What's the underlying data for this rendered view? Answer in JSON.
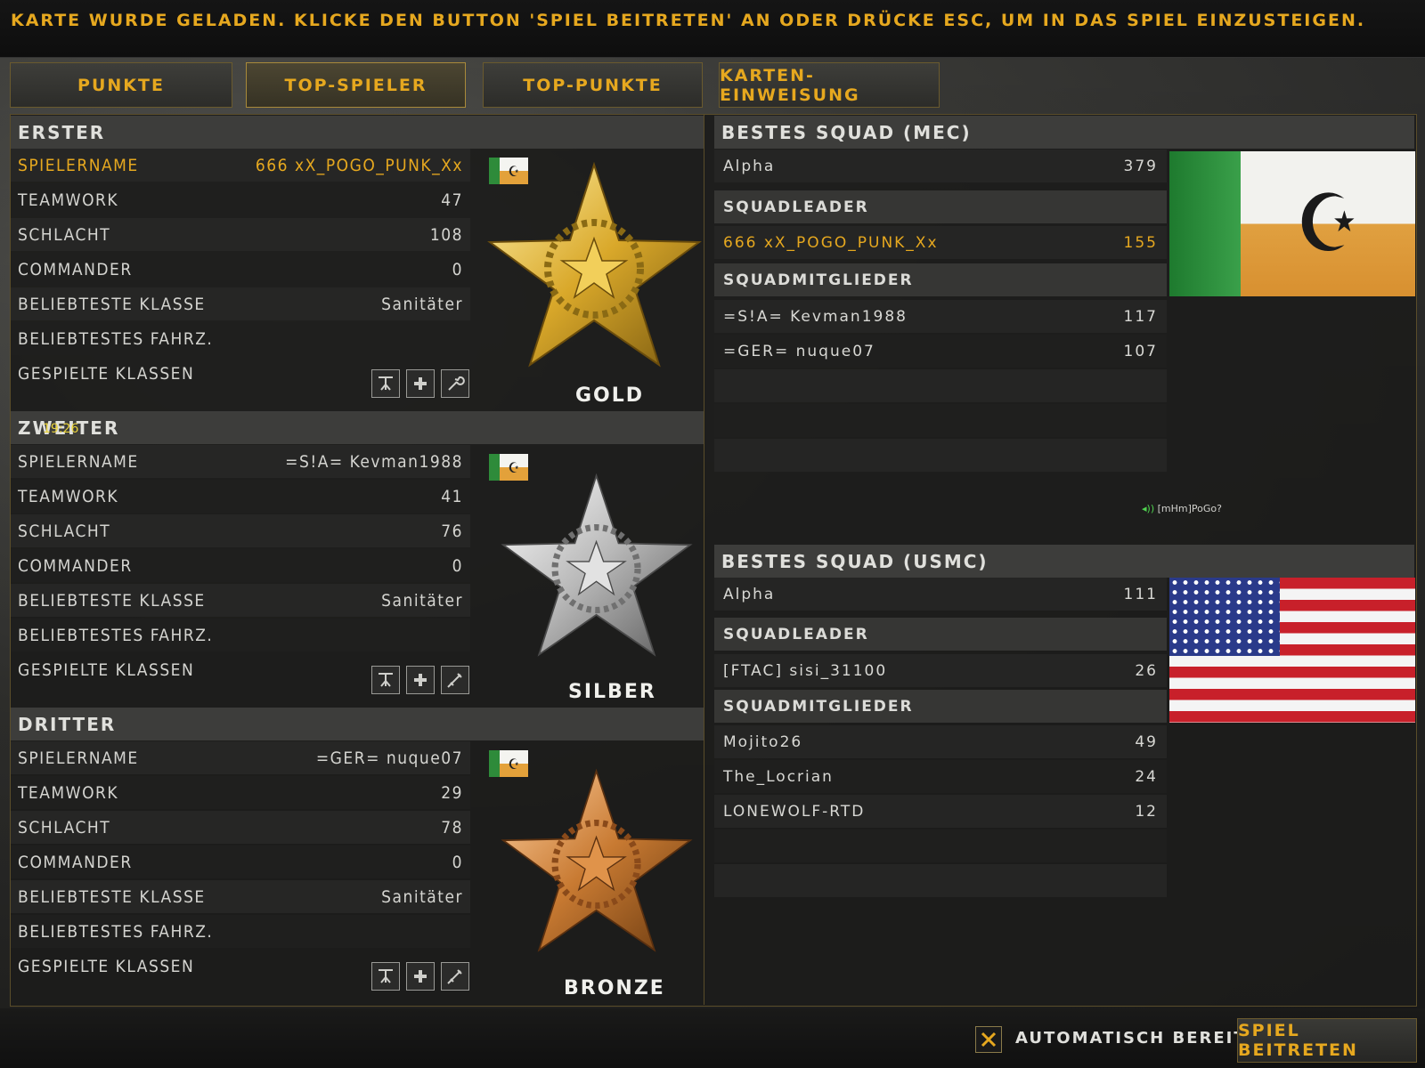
{
  "message": "KARTE WURDE GELADEN. KLICKE DEN BUTTON 'SPIEL BEITRETEN' AN ODER DRÜCKE ESC, UM IN DAS SPIEL EINZUSTEIGEN.",
  "tabs": [
    {
      "label": "PUNKTE",
      "active": false
    },
    {
      "label": "TOP-SPIELER",
      "active": true
    },
    {
      "label": "TOP-PUNKTE",
      "active": false
    },
    {
      "label": "KARTEN-EINWEISUNG",
      "active": false
    }
  ],
  "labels": {
    "spielername": "SPIELERNAME",
    "teamwork": "TEAMWORK",
    "schlacht": "SCHLACHT",
    "commander": "COMMANDER",
    "klasse": "BELIEBTESTE KLASSE",
    "fahrz": "BELIEBTESTES FAHRZ.",
    "gespielt": "GESPIELTE KLASSEN"
  },
  "players": [
    {
      "rank": "ERSTER",
      "name": "666 xX_POGO_PUNK_Xx",
      "teamwork": "47",
      "schlacht": "108",
      "commander": "0",
      "klasse": "Sanitäter",
      "fahrz": "",
      "medal": "GOLD",
      "highlight": true
    },
    {
      "rank": "ZWEITER",
      "name": "=S!A= Kevman1988",
      "teamwork": "41",
      "schlacht": "76",
      "commander": "0",
      "klasse": "Sanitäter",
      "fahrz": "",
      "medal": "SILBER",
      "highlight": false
    },
    {
      "rank": "DRITTER",
      "name": "=GER= nuque07",
      "teamwork": "29",
      "schlacht": "78",
      "commander": "0",
      "klasse": "Sanitäter",
      "fahrz": "",
      "medal": "BRONZE",
      "highlight": false
    }
  ],
  "timer": "19:26",
  "squads": [
    {
      "title": "BESTES SQUAD (MEC)",
      "name": "Alpha",
      "score": "379",
      "leader_label": "SQUADLEADER",
      "leader": {
        "name": "666 xX_POGO_PUNK_Xx",
        "score": "155"
      },
      "members_label": "SQUADMITGLIEDER",
      "members": [
        {
          "name": "=S!A= Kevman1988",
          "score": "117"
        },
        {
          "name": "=GER= nuque07",
          "score": "107"
        }
      ]
    },
    {
      "title": "BESTES SQUAD (USMC)",
      "name": "Alpha",
      "score": "111",
      "leader_label": "SQUADLEADER",
      "leader": {
        "name": "[FTAC] sisi_31100",
        "score": "26"
      },
      "members_label": "SQUADMITGLIEDER",
      "members": [
        {
          "name": "Mojito26",
          "score": "49"
        },
        {
          "name": "The_Locrian",
          "score": "24"
        },
        {
          "name": "LONEWOLF-RTD",
          "score": "12"
        }
      ]
    }
  ],
  "voice": "[mHm]PoGo?",
  "auto_ready": "AUTOMATISCH BEREIT",
  "join": "SPIEL BEITRETEN",
  "colors": {
    "accent": "#e6a81f",
    "gold": "#d9a82a",
    "silver": "#c8c8c8",
    "bronze": "#c87a32"
  }
}
